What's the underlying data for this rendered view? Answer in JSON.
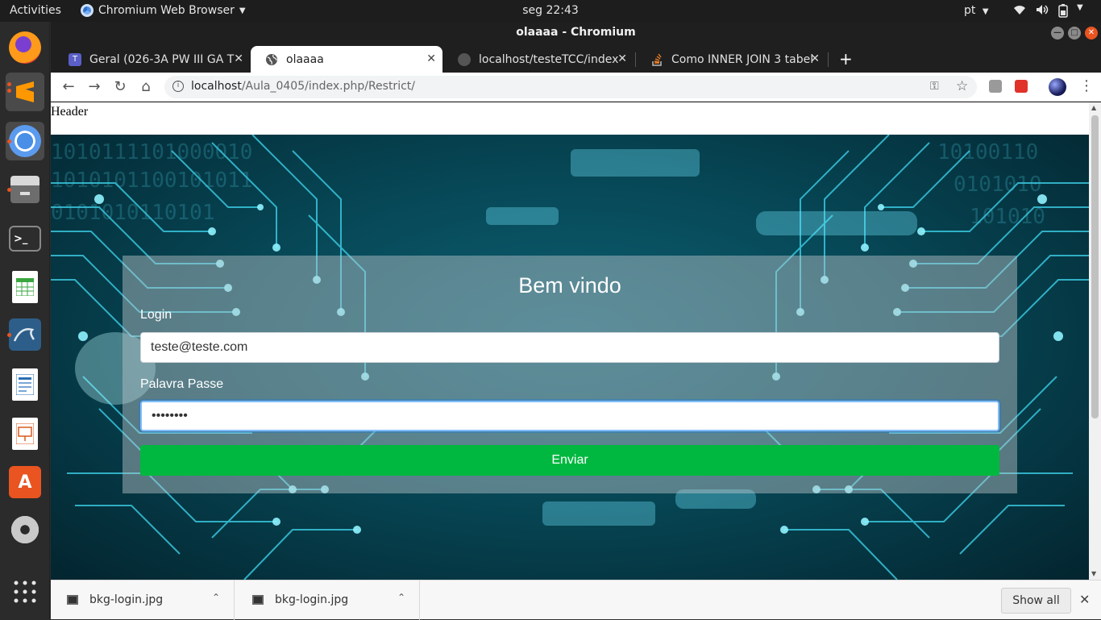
{
  "topbar": {
    "activities": "Activities",
    "app_menu": "Chromium Web Browser",
    "clock": "seg 22:43",
    "language": "pt"
  },
  "dock": {
    "items": [
      "firefox-icon",
      "sublime-text-icon",
      "chromium-icon",
      "file-manager-icon",
      "terminal-icon",
      "spreadsheet-icon",
      "mysql-workbench-icon",
      "writer-icon",
      "impress-icon",
      "software-center-icon",
      "settings-icon",
      "apps-grid-icon"
    ]
  },
  "window": {
    "title": "olaaaa - Chromium"
  },
  "tabs": [
    {
      "label": "Geral (026-3A PW III GA TE",
      "active": false
    },
    {
      "label": "olaaaa",
      "active": true
    },
    {
      "label": "localhost/testeTCC/index",
      "active": false
    },
    {
      "label": "Como INNER JOIN 3 tabel",
      "active": false
    }
  ],
  "omnibox": {
    "url_host": "localhost",
    "url_path": "/Aula_0405/index.php/Restrict/"
  },
  "page": {
    "header": "Header",
    "login_card": {
      "title": "Bem vindo",
      "login_label": "Login",
      "login_value": "teste@teste.com",
      "password_label": "Palavra Passe",
      "password_value": "••••••••",
      "submit_label": "Enviar"
    }
  },
  "downloads": {
    "items": [
      "bkg-login.jpg",
      "bkg-login.jpg"
    ],
    "show_all": "Show all"
  },
  "colors": {
    "submit_button": "#00b83f",
    "ubuntu_accent": "#e95420",
    "background_teal": "#074857"
  }
}
